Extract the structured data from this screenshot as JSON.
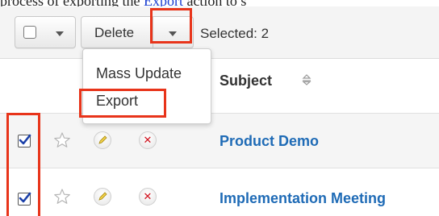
{
  "intro": {
    "text": "process of exporting the ",
    "link": "Export",
    "text_after": " action to s"
  },
  "toolbar": {
    "delete_label": "Delete",
    "selected_text": "Selected: 2"
  },
  "actions_menu": {
    "items": [
      "Mass Update",
      "Export"
    ],
    "highlighted_item": "Export"
  },
  "list": {
    "header": {
      "subject_label": "Subject"
    },
    "rows": [
      {
        "subject": "Product Demo",
        "checked": true
      },
      {
        "subject": "Implementation Meeting",
        "checked": true
      }
    ]
  },
  "colors": {
    "highlight": "#e8341a",
    "link": "#1f6bb6",
    "delete_x": "#d0101c"
  }
}
